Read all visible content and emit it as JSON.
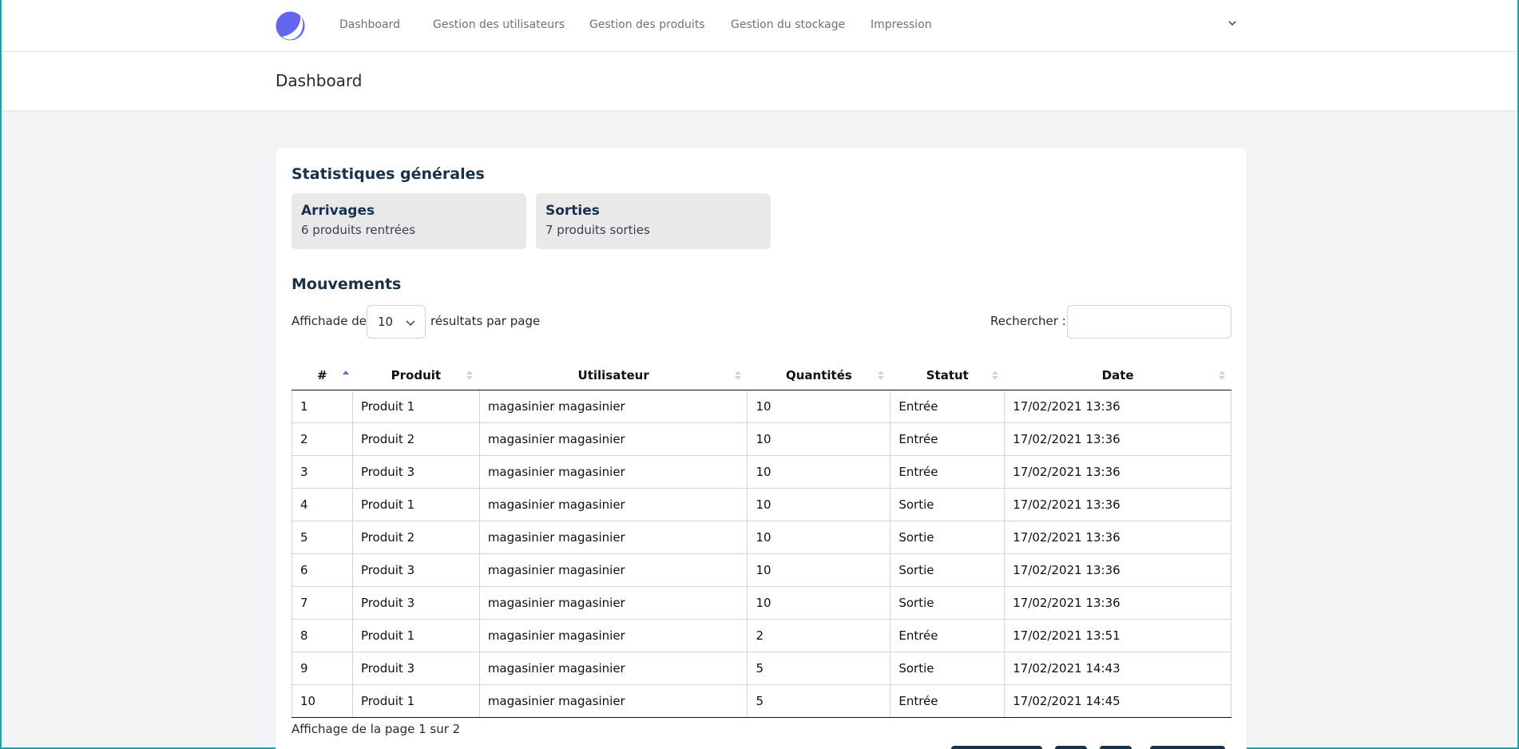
{
  "nav": {
    "items": [
      {
        "label": "Dashboard"
      },
      {
        "label": "Gestion des utilisateurs"
      },
      {
        "label": "Gestion des produits"
      },
      {
        "label": "Gestion du stockage"
      },
      {
        "label": "Impression"
      }
    ],
    "logo_icon": "crescent-logo-icon",
    "menu_icon": "chevron-down-icon",
    "accent": "#6366f1"
  },
  "header": {
    "title": "Dashboard"
  },
  "stats": {
    "title": "Statistiques générales",
    "arrivals": {
      "title": "Arrivages",
      "subtitle": "6 produits rentrées"
    },
    "exits": {
      "title": "Sorties",
      "subtitle": "7 produits sorties"
    }
  },
  "movements": {
    "title": "Mouvements",
    "length_prefix": "Affichade de",
    "length_value": "10",
    "length_suffix": "résultats par page",
    "search_label": "Rechercher :",
    "search_value": "",
    "columns": [
      "#",
      "Produit",
      "Utilisateur",
      "Quantités",
      "Statut",
      "Date"
    ],
    "rows": [
      {
        "id": "1",
        "product": "Produit 1",
        "user": "magasinier magasinier",
        "qty": "10",
        "status": "Entrée",
        "date": "17/02/2021 13:36"
      },
      {
        "id": "2",
        "product": "Produit 2",
        "user": "magasinier magasinier",
        "qty": "10",
        "status": "Entrée",
        "date": "17/02/2021 13:36"
      },
      {
        "id": "3",
        "product": "Produit 3",
        "user": "magasinier magasinier",
        "qty": "10",
        "status": "Entrée",
        "date": "17/02/2021 13:36"
      },
      {
        "id": "4",
        "product": "Produit 1",
        "user": "magasinier magasinier",
        "qty": "10",
        "status": "Sortie",
        "date": "17/02/2021 13:36"
      },
      {
        "id": "5",
        "product": "Produit 2",
        "user": "magasinier magasinier",
        "qty": "10",
        "status": "Sortie",
        "date": "17/02/2021 13:36"
      },
      {
        "id": "6",
        "product": "Produit 3",
        "user": "magasinier magasinier",
        "qty": "10",
        "status": "Sortie",
        "date": "17/02/2021 13:36"
      },
      {
        "id": "7",
        "product": "Produit 3",
        "user": "magasinier magasinier",
        "qty": "10",
        "status": "Sortie",
        "date": "17/02/2021 13:36"
      },
      {
        "id": "8",
        "product": "Produit 1",
        "user": "magasinier magasinier",
        "qty": "2",
        "status": "Entrée",
        "date": "17/02/2021 13:51"
      },
      {
        "id": "9",
        "product": "Produit 3",
        "user": "magasinier magasinier",
        "qty": "5",
        "status": "Sortie",
        "date": "17/02/2021 14:43"
      },
      {
        "id": "10",
        "product": "Produit 1",
        "user": "magasinier magasinier",
        "qty": "5",
        "status": "Entrée",
        "date": "17/02/2021 14:45"
      }
    ],
    "info": "Affichage de la page 1 sur 2"
  }
}
